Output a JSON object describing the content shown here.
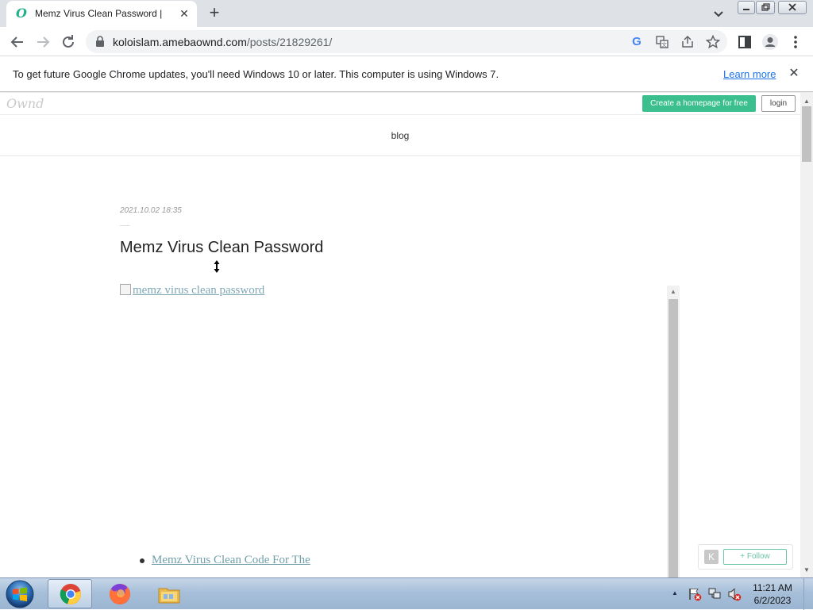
{
  "browser": {
    "tab_title": "Memz Virus Clean Password |",
    "tab_favicon": "O",
    "tab_close": "✕",
    "new_tab": "+",
    "url_host": "koloislam.amebaownd.com",
    "url_path": "/posts/21829261/"
  },
  "infobar": {
    "message": "To get future Google Chrome updates, you'll need Windows 10 or later. This computer is using Windows 7.",
    "link": "Learn more",
    "close": "✕"
  },
  "site": {
    "logo": "Ownd",
    "create_button": "Create a homepage for free",
    "login_button": "login",
    "nav_blog": "blog"
  },
  "post": {
    "date": "2021.10.02 18:35",
    "title": "Memz Virus Clean Password",
    "image_alt": "memz virus clean password",
    "list_link": "Memz Virus Clean Code For The"
  },
  "follow_widget": {
    "badge": "K",
    "follow_label": "+ Follow"
  },
  "taskbar": {
    "time": "11:21 AM",
    "date": "6/2/2023"
  },
  "colors": {
    "accent_green": "#3bbf8f",
    "link_blue": "#1a73e8",
    "link_teal": "#6f9eaa"
  },
  "icons": [
    "back-icon",
    "forward-icon",
    "reload-icon",
    "lock-icon",
    "google-icon",
    "translate-icon",
    "share-icon",
    "star-icon",
    "side-panel-icon",
    "profile-icon",
    "menu-icon",
    "chrome-icon",
    "firefox-icon",
    "folder-icon",
    "windows-start-icon"
  ]
}
